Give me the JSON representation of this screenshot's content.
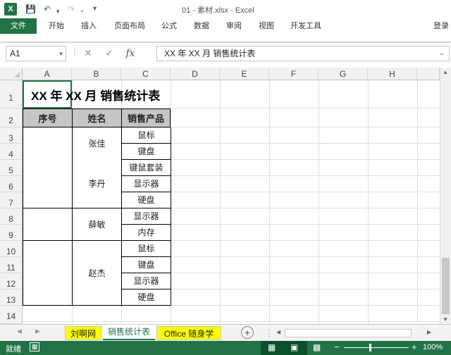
{
  "titlebar": {
    "app_icon": "X",
    "title": "01 - 素材.xlsx - Excel"
  },
  "ribbon": {
    "tabs": [
      "文件",
      "开始",
      "插入",
      "页面布局",
      "公式",
      "数据",
      "审阅",
      "视图",
      "开发工具"
    ],
    "login": "登录"
  },
  "formula_bar": {
    "name_box": "A1",
    "content": "XX 年 XX 月 销售统计表",
    "fx": "fx"
  },
  "grid": {
    "columns": [
      "A",
      "B",
      "C",
      "D",
      "E",
      "F",
      "G",
      "H"
    ],
    "rows": [
      "1",
      "2",
      "3",
      "4",
      "5",
      "6",
      "7",
      "8",
      "9",
      "10",
      "11",
      "12",
      "13",
      "14"
    ]
  },
  "sheet_content": {
    "title": "XX 年 XX 月 销售统计表",
    "headers": [
      "序号",
      "姓名",
      "销售产品"
    ],
    "names": [
      "张佳",
      "李丹",
      "薛敏",
      "赵杰"
    ],
    "products": [
      "鼠标",
      "键盘",
      "键鼠套装",
      "显示器",
      "硬盘",
      "显示器",
      "内存",
      "鼠标",
      "键盘",
      "显示器",
      "硬盘"
    ]
  },
  "sheets": [
    {
      "label": "刘啊网",
      "bg": "#ffff00"
    },
    {
      "label": "销售统计表",
      "bg": "#ffffff"
    },
    {
      "label": "Office 随身学",
      "bg": "#ffff00"
    }
  ],
  "status": {
    "ready": "就绪",
    "zoom": "100%"
  },
  "colors": {
    "excel_green": "#217346",
    "header_fill": "#c6c6c6"
  }
}
